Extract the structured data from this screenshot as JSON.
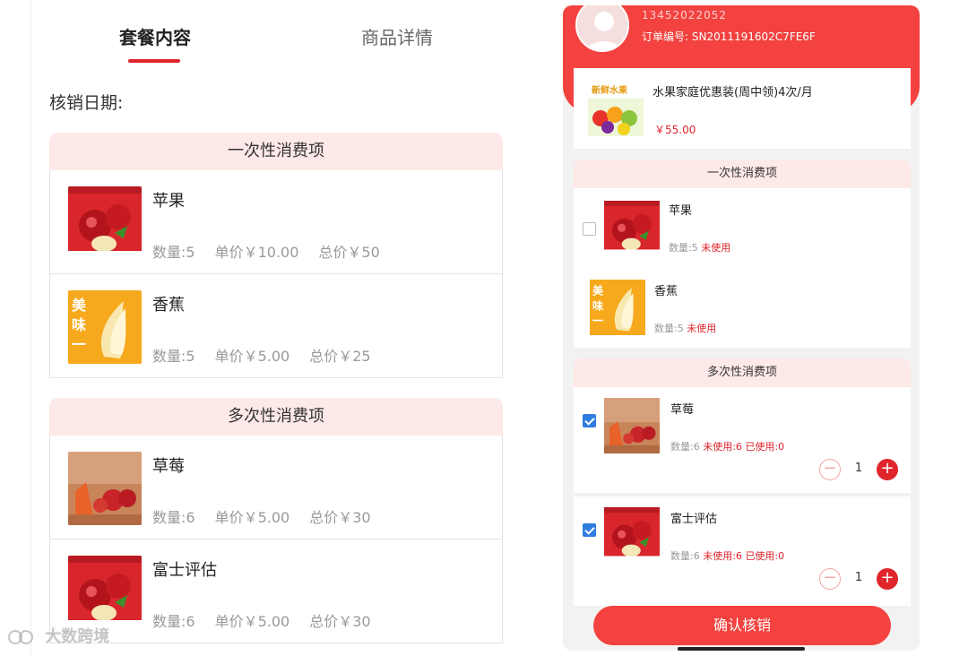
{
  "left": {
    "tabs": [
      {
        "label": "套餐内容",
        "active": true
      },
      {
        "label": "商品详情",
        "active": false
      }
    ],
    "verify_date_label": "核销日期:",
    "sections": [
      {
        "title": "一次性消费项",
        "items": [
          {
            "name": "苹果",
            "qty": "数量:5",
            "unit_price": "单价￥10.00",
            "total": "总价￥50",
            "image": "apple-image"
          },
          {
            "name": "香蕉",
            "qty": "数量:5",
            "unit_price": "单价￥5.00",
            "total": "总价￥25",
            "image": "banana-image"
          }
        ]
      },
      {
        "title": "多次性消费项",
        "items": [
          {
            "name": "草莓",
            "qty": "数量:6",
            "unit_price": "单价￥5.00",
            "total": "总价￥30",
            "image": "strawberry-image"
          },
          {
            "name": "富士评估",
            "qty": "数量:6",
            "unit_price": "单价￥5.00",
            "total": "总价￥30",
            "image": "apple-image"
          }
        ]
      }
    ]
  },
  "right": {
    "header": {
      "phone": "13452022052",
      "order_no": "订单编号: SN2011191602C7FE6F"
    },
    "product": {
      "title": "水果家庭优惠装(周中领)4次/月",
      "price": "￥55.00",
      "image_text": "新鲜水果"
    },
    "one_time": {
      "title": "一次性消费项",
      "items": [
        {
          "name": "苹果",
          "qty": "数量:5",
          "status": "未使用",
          "checked": false
        },
        {
          "name": "香蕉",
          "qty": "数量:5",
          "status": "未使用",
          "checked": null
        }
      ]
    },
    "multi": {
      "title": "多次性消费项",
      "items": [
        {
          "name": "草莓",
          "qty": "数量:6",
          "unused": "未使用:6",
          "used": "已使用:0",
          "count": "1",
          "checked": true
        },
        {
          "name": "富士评估",
          "qty": "数量:6",
          "unused": "未使用:6",
          "used": "已使用:0",
          "count": "1",
          "checked": true
        }
      ]
    },
    "confirm_label": "确认核销"
  },
  "watermark": "大数跨境",
  "colors": {
    "accent": "#e0242c",
    "header": "#f3423f",
    "section_bg": "#fde9e8",
    "checkbox": "#2f7de1"
  }
}
